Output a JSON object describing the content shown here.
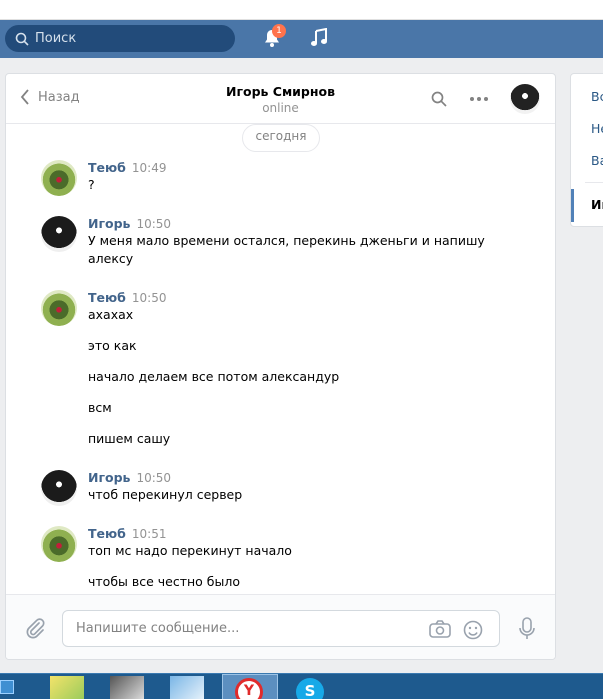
{
  "header": {
    "search_placeholder": "Поиск",
    "notifications_count": "1",
    "bell_icon": "bell-icon",
    "music_icon": "music-note-icon"
  },
  "chat": {
    "back_label": "Назад",
    "title": "Игорь Смирнов",
    "status": "online",
    "date_divider": "сегодня",
    "messages": [
      {
        "author": "Теюб",
        "time": "10:49",
        "lines": [
          "?"
        ]
      },
      {
        "author": "Игорь",
        "time": "10:50",
        "lines": [
          "У меня мало времени остался, перекинь дженьги и напишу",
          "алексу"
        ]
      },
      {
        "author": "Теюб",
        "time": "10:50",
        "lines": [
          "ахахах",
          "это как",
          "начало делаем все потом александур",
          "всм",
          "пишем сашу"
        ]
      },
      {
        "author": "Игорь",
        "time": "10:50",
        "lines": [
          "чтоб перекинул сервер"
        ]
      },
      {
        "author": "Теюб",
        "time": "10:51",
        "lines": [
          "топ мс надо перекинут начало",
          "чтобы все честно было"
        ]
      }
    ],
    "composer_placeholder": "Напишите сообщение..."
  },
  "sidebar": {
    "items": [
      "Вс",
      "Не",
      "Ва",
      "Иг"
    ]
  },
  "colors": {
    "header_bg": "#4a76a8",
    "name_color": "#42648b",
    "accent": "#5181b8",
    "badge": "#ff734c"
  }
}
